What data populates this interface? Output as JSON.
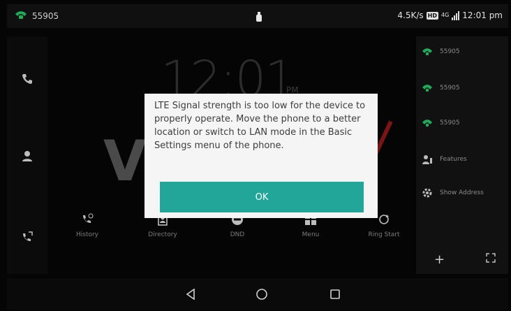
{
  "status_bar": {
    "line_number": "55905",
    "network_speed": "4.5K/s",
    "hd_badge": "HD",
    "network_type": "4G",
    "time": "12:01 pm"
  },
  "clock": {
    "time": "12:01",
    "ampm": "PM"
  },
  "watermark": {
    "letter": "V"
  },
  "dialog": {
    "message": "LTE Signal strength is too low for the device to properly operate. Move the phone to a better location or switch to LAN mode in the Basic Settings menu of the phone.",
    "ok_label": "OK"
  },
  "softkeys": [
    {
      "label": "History",
      "icon": "history-icon"
    },
    {
      "label": "Directory",
      "icon": "directory-icon"
    },
    {
      "label": "DND",
      "icon": "dnd-icon"
    },
    {
      "label": "Menu",
      "icon": "menu-icon"
    },
    {
      "label": "Ring Start",
      "icon": "ring-start-icon"
    }
  ],
  "right_panel": {
    "lines": [
      "55905",
      "55905",
      "55905"
    ],
    "features_label": "Features",
    "show_address_label": "Show Address",
    "plus_label": "+"
  },
  "colors": {
    "accent": "#23a69a",
    "line_green": "#1faa5a"
  }
}
